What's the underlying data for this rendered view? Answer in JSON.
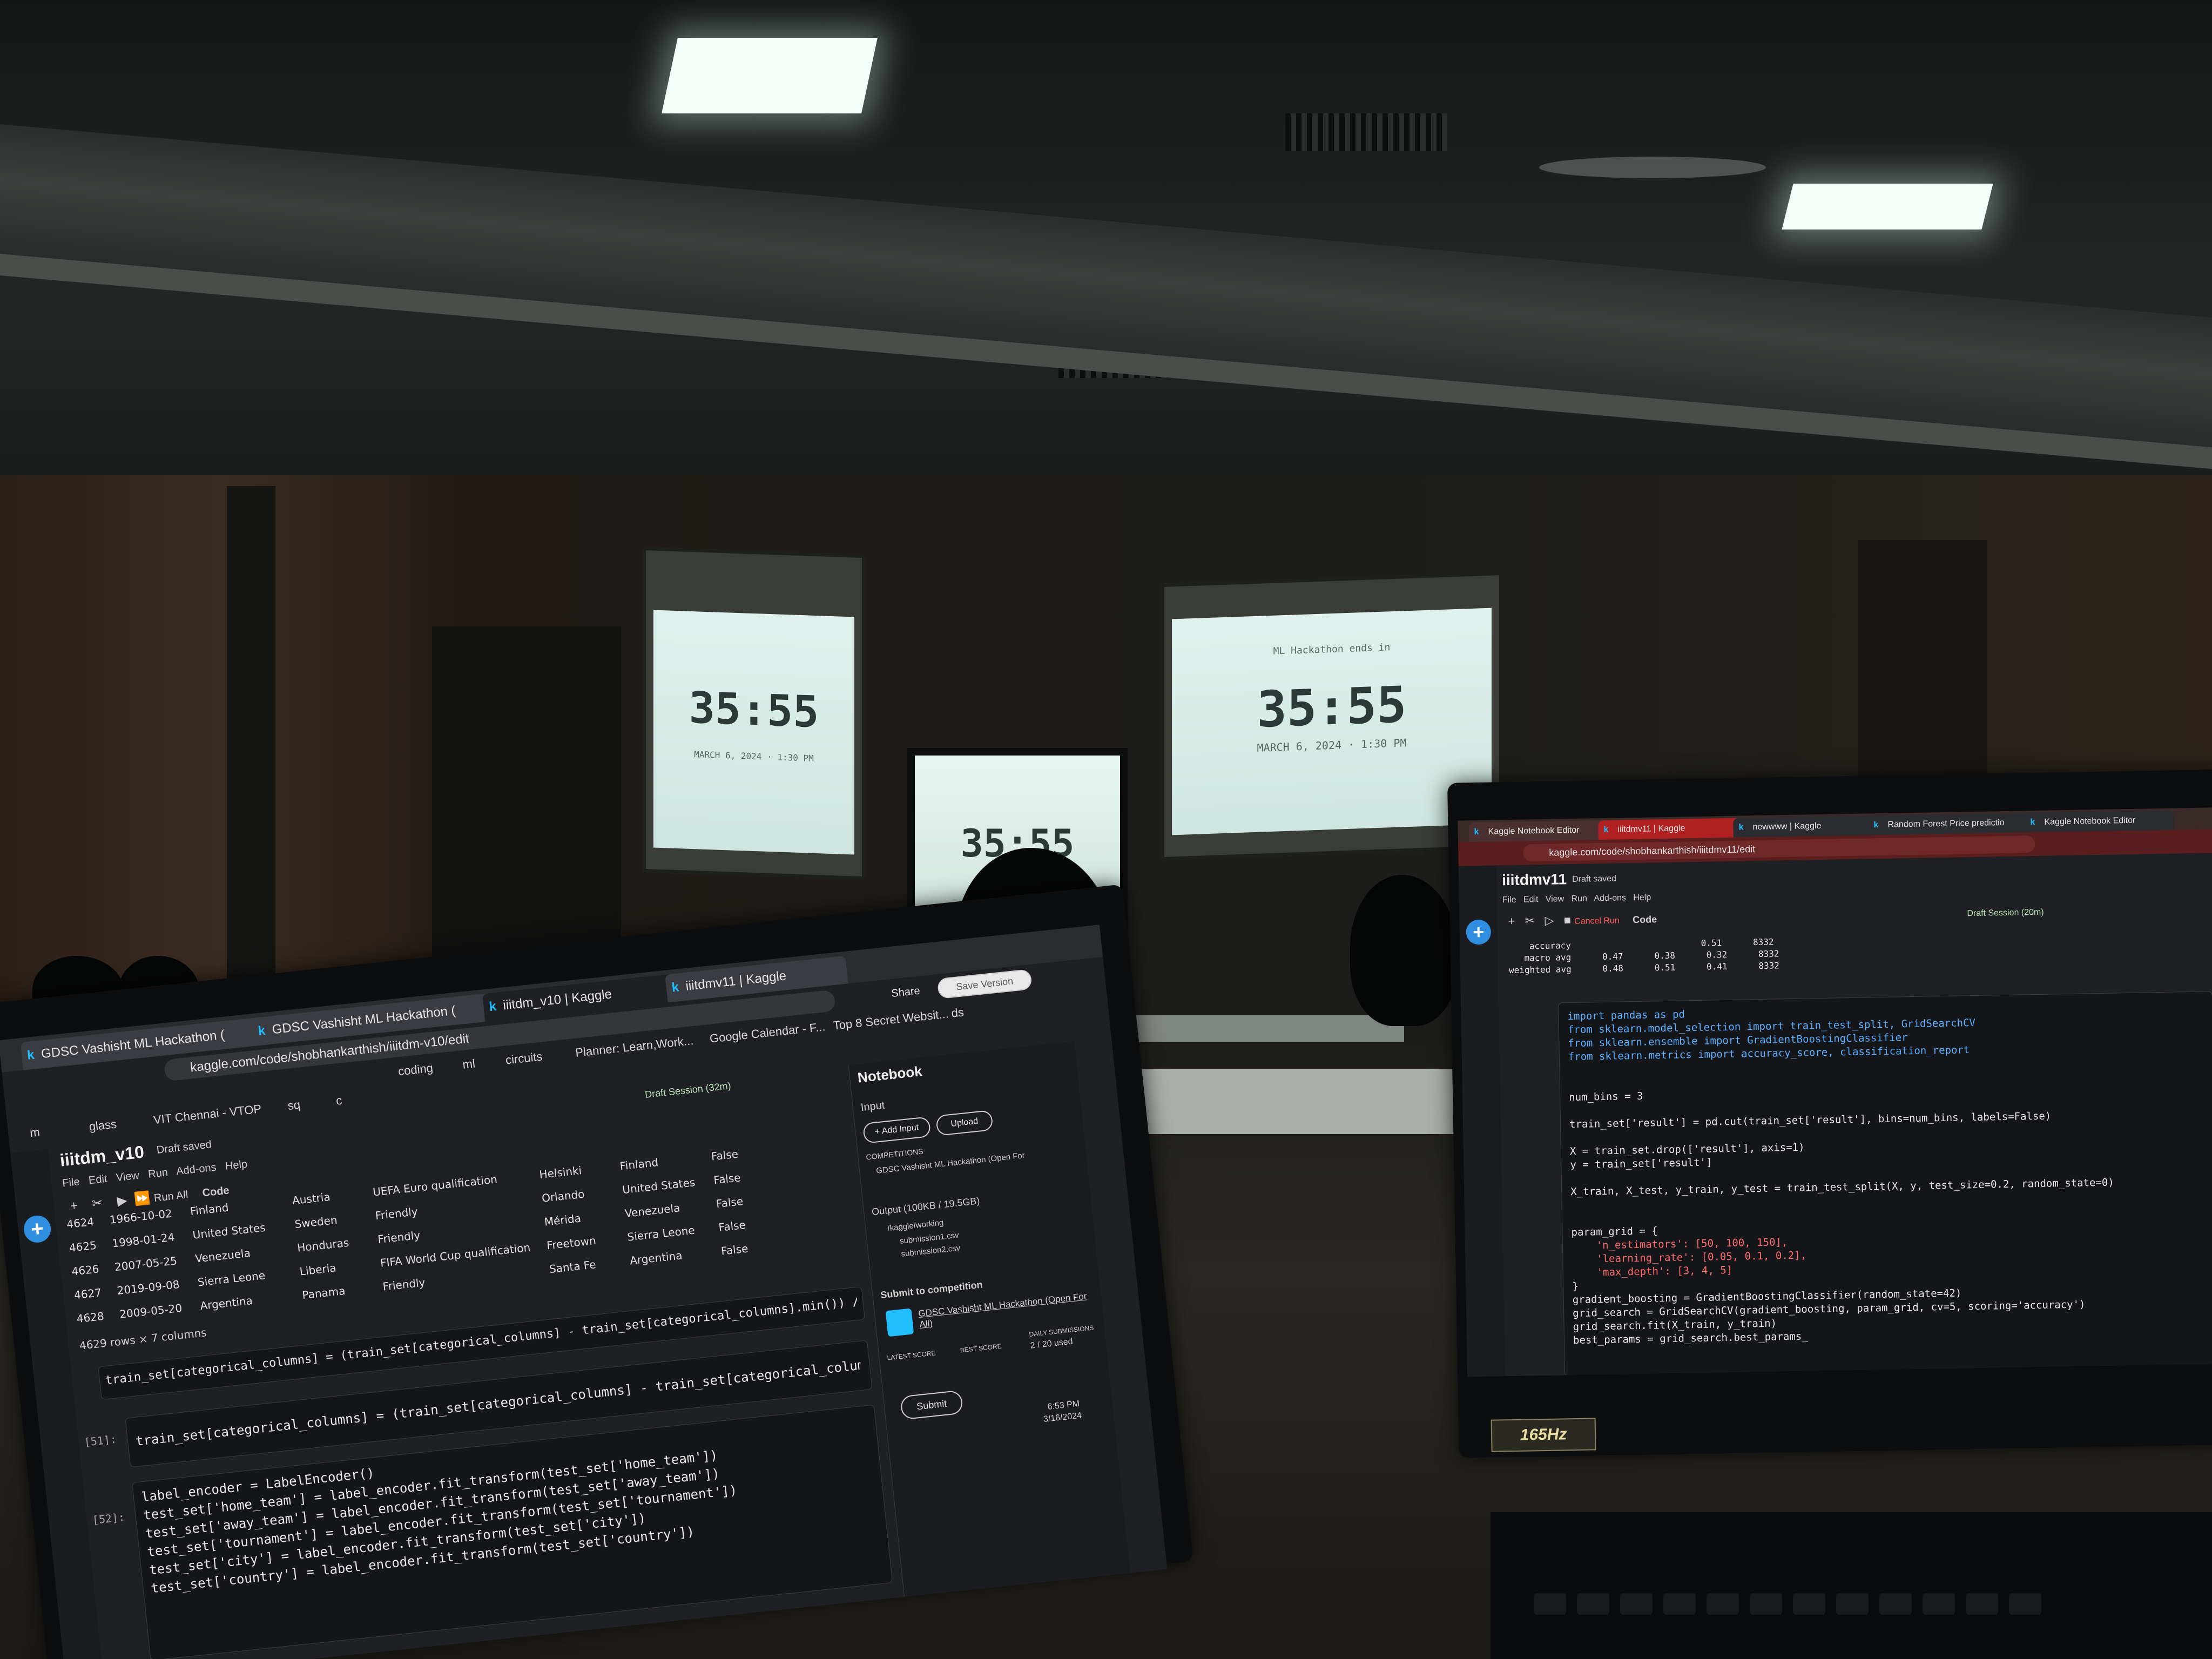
{
  "room": {
    "countdown_left": "35:55",
    "countdown_center": "35:55",
    "countdown_right": "35:55",
    "date_left": "MARCH 6, 2024 · 1:30 PM",
    "date_right": "MARCH 6, 2024 · 1:30 PM",
    "headline_right": "ML Hackathon ends in",
    "laptop_badge": "165Hz"
  },
  "left_laptop": {
    "tabs": [
      "GDSC Vashisht ML Hackathon (",
      "GDSC Vashisht ML Hackathon (",
      "iiitdm_v10 | Kaggle",
      "iiitdmv11 | Kaggle"
    ],
    "url": "kaggle.com/code/shobhankarthish/iiitdm-v10/edit",
    "bookmarks_row1": [
      "coding",
      "ml",
      "circuits",
      "Planner: Learn,Work...",
      "Google Calendar - F...",
      "Top 8 Secret Websit...",
      "ds"
    ],
    "bookmarks_row2": [
      "m",
      "glass",
      "VIT Chennai - VTOP",
      "sq",
      "c"
    ],
    "share_label": "Share",
    "save_label": "Save Version",
    "notebook_title": "iiitdm_v10",
    "draft_status": "Draft saved",
    "menus": [
      "File",
      "Edit",
      "View",
      "Run",
      "Add-ons",
      "Help"
    ],
    "run_all": "Run All",
    "cell_type": "Code",
    "session": "Draft Session (32m)",
    "table_rows": [
      {
        "idx": "4624",
        "date": "1966-10-02",
        "home": "Finland",
        "away": "Austria",
        "tournament": "UEFA Euro qualification",
        "city": "Helsinki",
        "country": "Finland",
        "neutral": "False"
      },
      {
        "idx": "4625",
        "date": "1998-01-24",
        "home": "United States",
        "away": "Sweden",
        "tournament": "Friendly",
        "city": "Orlando",
        "country": "United States",
        "neutral": "False"
      },
      {
        "idx": "4626",
        "date": "2007-05-25",
        "home": "Venezuela",
        "away": "Honduras",
        "tournament": "Friendly",
        "city": "Mérida",
        "country": "Venezuela",
        "neutral": "False"
      },
      {
        "idx": "4627",
        "date": "2019-09-08",
        "home": "Sierra Leone",
        "away": "Liberia",
        "tournament": "FIFA World Cup qualification",
        "city": "Freetown",
        "country": "Sierra Leone",
        "neutral": "False"
      },
      {
        "idx": "4628",
        "date": "2009-05-20",
        "home": "Argentina",
        "away": "Panama",
        "tournament": "Friendly",
        "city": "Santa Fe",
        "country": "Argentina",
        "neutral": "False"
      }
    ],
    "rows_summary": "4629 rows × 7 columns",
    "cell51_label": "[51]:",
    "cell51_code": "train_set[categorical_columns] = (train_set[categorical_columns] - train_set[categorical_columns].min()) / (train_set[categori",
    "cell52_label": "[52]:",
    "cell52_lines": [
      "label_encoder = LabelEncoder()",
      "test_set['home_team'] = label_encoder.fit_transform(test_set['home_team'])",
      "test_set['away_team'] = label_encoder.fit_transform(test_set['away_team'])",
      "test_set['tournament'] = label_encoder.fit_transform(test_set['tournament'])",
      "test_set['city'] = label_encoder.fit_transform(test_set['city'])",
      "test_set['country'] = label_encoder.fit_transform(test_set['country'])"
    ],
    "panel": {
      "title": "Notebook",
      "input": "Input",
      "add_input": "+ Add Input",
      "upload": "Upload",
      "competitions": "COMPETITIONS",
      "competition": "GDSC Vashisht ML Hackathon (Open For",
      "output": "Output (100KB / 19.5GB)",
      "folder": "/kaggle/working",
      "files": [
        "submission1.csv",
        "submission2.csv"
      ],
      "submit_header": "Submit to competition",
      "submit_comp": "GDSC Vashisht ML Hackathon (Open For All)",
      "latest_score": "LATEST SCORE",
      "best_score": "BEST SCORE",
      "daily": "DAILY SUBMISSIONS",
      "used": "2 / 20 used",
      "submit": "Submit"
    },
    "clock_time": "6:53 PM",
    "clock_date": "3/16/2024"
  },
  "right_laptop": {
    "tabs": [
      "Kaggle Notebook Editor",
      "iiitdmv11 | Kaggle",
      "newwww | Kaggle",
      "Random Forest Price predictio",
      "Kaggle Notebook Editor"
    ],
    "url": "kaggle.com/code/shobhankarthish/iiitdmv11/edit",
    "notebook_title": "iiitdmv11",
    "draft_status": "Draft saved",
    "menus": [
      "File",
      "Edit",
      "View",
      "Run",
      "Add-ons",
      "Help"
    ],
    "cancel_run": "Cancel Run",
    "cell_type": "Code",
    "session": "Draft Session (20m)",
    "report_lines": [
      "    accuracy                         0.51      8332",
      "   macro avg      0.47      0.38      0.32      8332",
      "weighted avg      0.48      0.51      0.41      8332"
    ],
    "code_lines": [
      "import pandas as pd",
      "from sklearn.model_selection import train_test_split, GridSearchCV",
      "from sklearn.ensemble import GradientBoostingClassifier",
      "from sklearn.metrics import accuracy_score, classification_report",
      "",
      "",
      "num_bins = 3",
      "",
      "train_set['result'] = pd.cut(train_set['result'], bins=num_bins, labels=False)",
      "",
      "X = train_set.drop(['result'], axis=1)",
      "y = train_set['result']",
      "",
      "X_train, X_test, y_train, y_test = train_test_split(X, y, test_size=0.2, random_state=0)",
      "",
      "",
      "param_grid = {",
      "    'n_estimators': [50, 100, 150],",
      "    'learning_rate': [0.05, 0.1, 0.2],",
      "    'max_depth': [3, 4, 5]",
      "}",
      "gradient_boosting = GradientBoostingClassifier(random_state=42)",
      "grid_search = GridSearchCV(gradient_boosting, param_grid, cv=5, scoring='accuracy')",
      "grid_search.fit(X_train, y_train)",
      "best_params = grid_search.best_params_"
    ]
  },
  "colors": {
    "kaggle_blue": "#20beff",
    "editor_bg": "#1f2023",
    "code_bg": "#151619",
    "string_red": "#ff6b6b",
    "keyword_blue": "#5ab0ff",
    "screen_glow": "#dff1ec"
  }
}
